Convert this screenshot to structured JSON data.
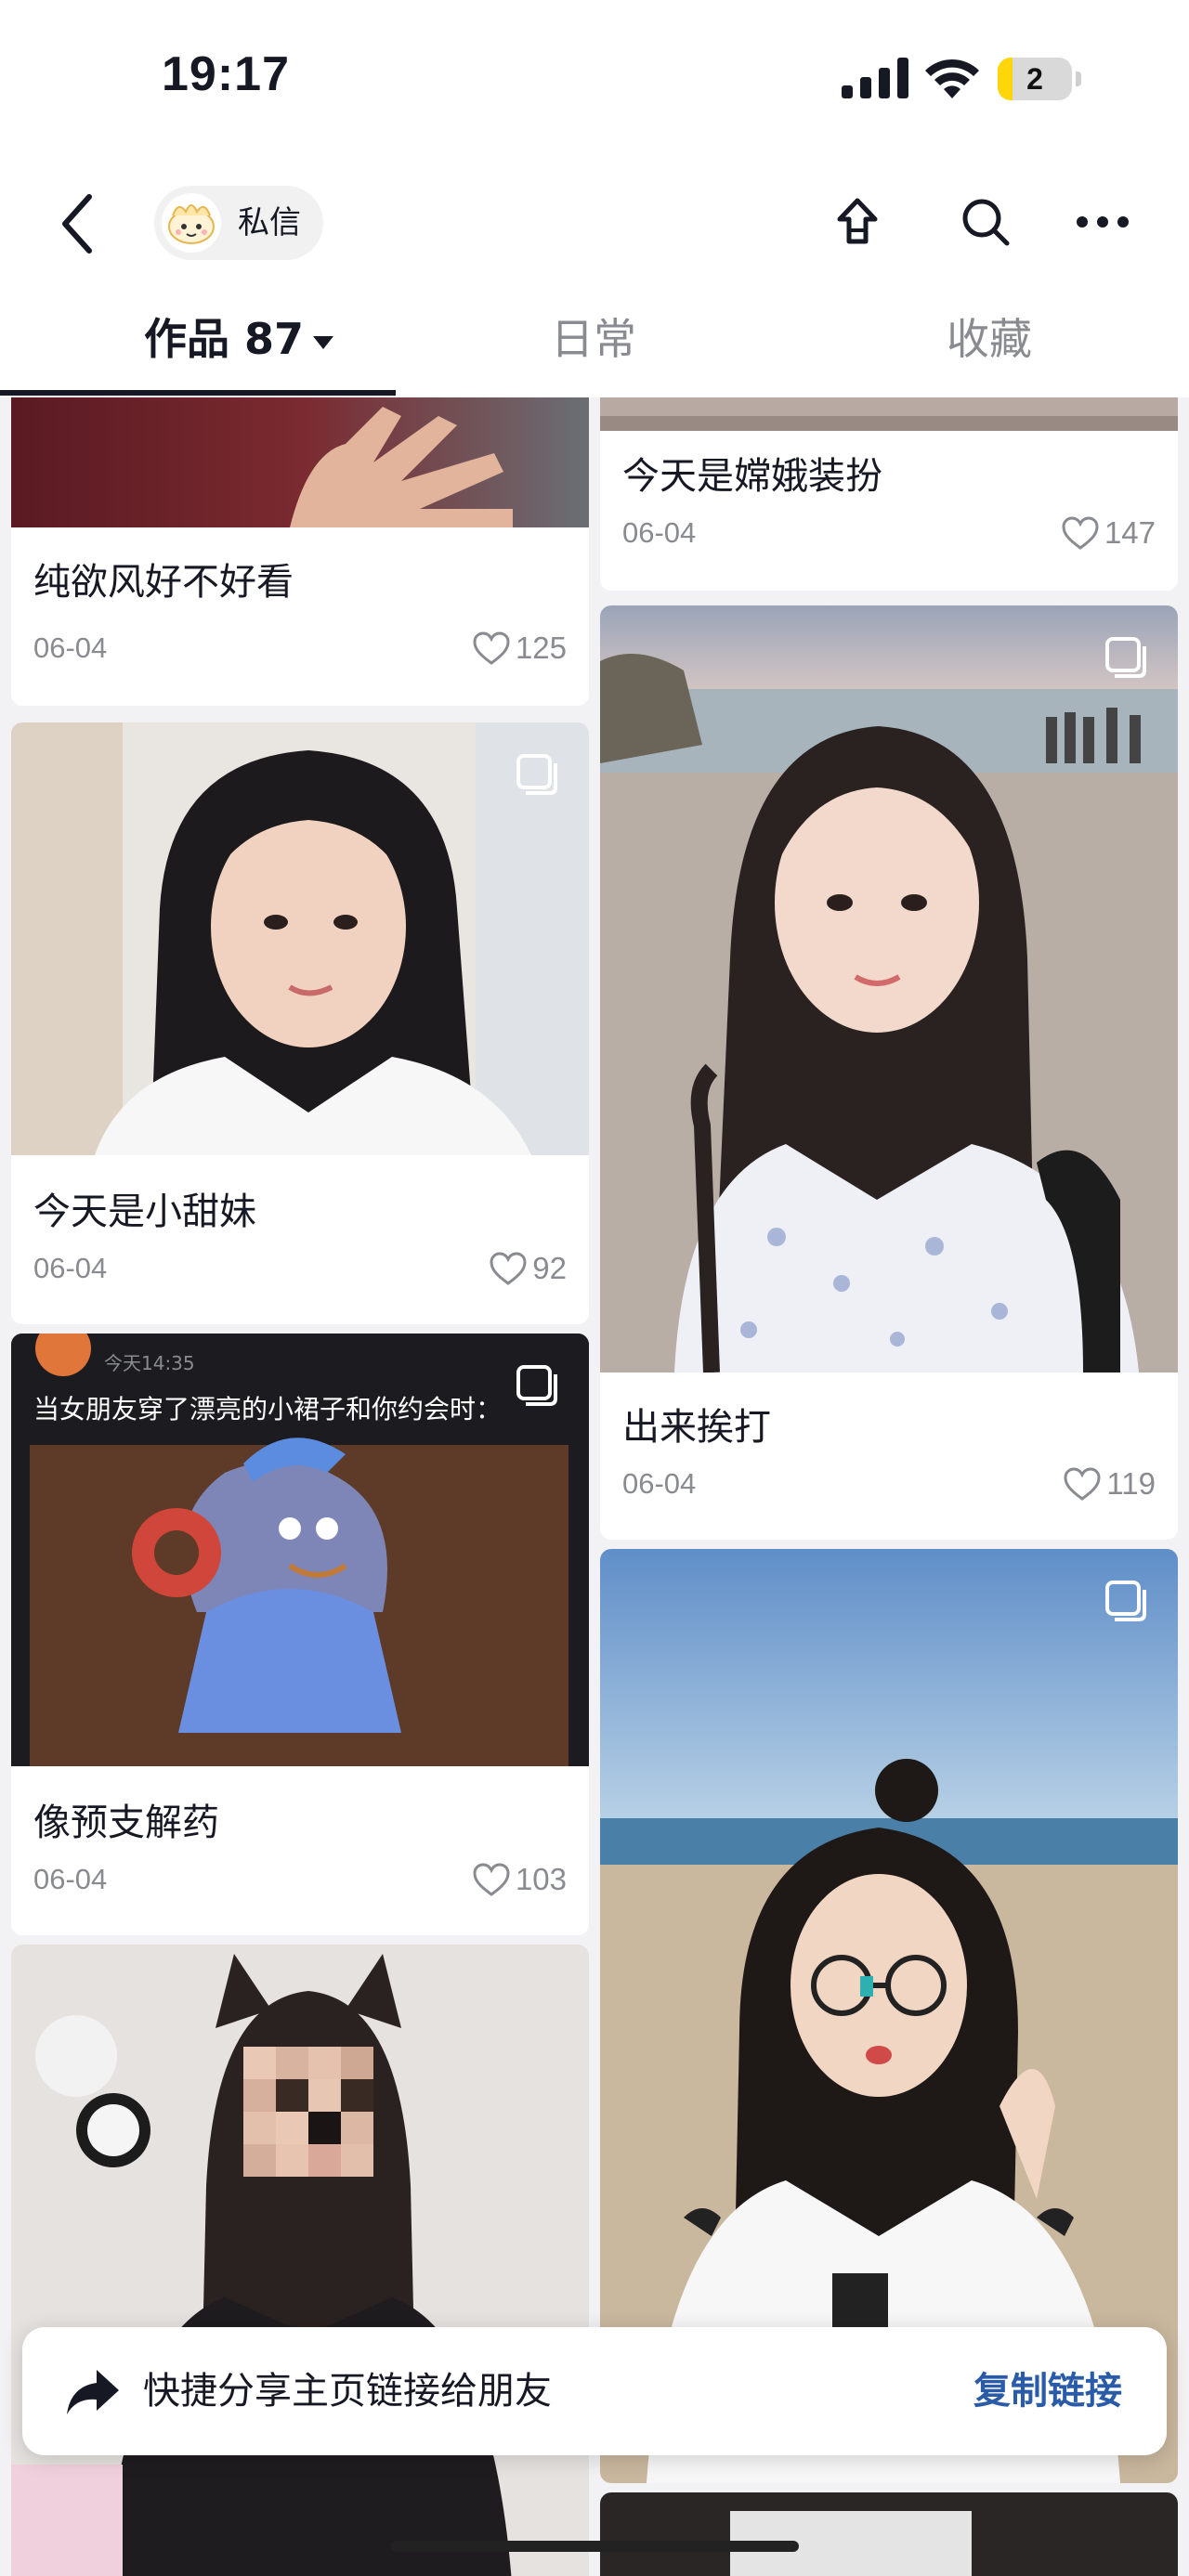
{
  "status_bar": {
    "time": "19:17",
    "battery": "2",
    "battery_level": 0.2
  },
  "nav": {
    "dm_label": "私信"
  },
  "tabs": [
    {
      "label": "作品 87",
      "active": true
    },
    {
      "label": "日常",
      "active": false
    },
    {
      "label": "收藏",
      "active": false
    }
  ],
  "posts": [
    {
      "title": "纯欲风好不好看",
      "date": "06-04",
      "likes": "125"
    },
    {
      "title": "今天是嫦娥装扮",
      "date": "06-04",
      "likes": "147"
    },
    {
      "title": "今天是小甜妹",
      "date": "06-04",
      "likes": "92"
    },
    {
      "title": "出来挨打",
      "date": "06-04",
      "likes": "119"
    },
    {
      "title": "像预支解药",
      "date": "06-04",
      "likes": "103"
    }
  ],
  "meme_post": {
    "time": "今天14:35",
    "caption": "当女朋友穿了漂亮的小裙子和你约会时："
  },
  "share_bar": {
    "text": "快捷分享主页链接给朋友",
    "action": "复制链接"
  },
  "colors": {
    "accent_link": "#2a5ba8",
    "battery_fill": "#ffd60a",
    "text_primary": "#161823",
    "text_secondary": "#8a8b91"
  }
}
